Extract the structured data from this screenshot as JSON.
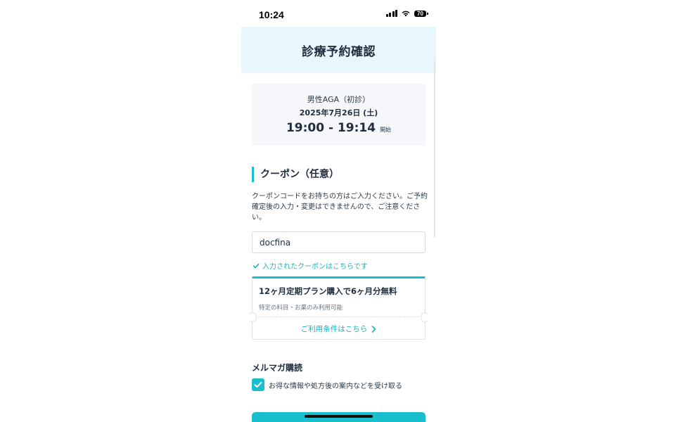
{
  "status_bar": {
    "time": "10:24",
    "battery": "70",
    "icons": [
      "signal-icon",
      "wifi-icon",
      "battery-icon"
    ]
  },
  "header": {
    "title": "診療予約確認"
  },
  "appointment": {
    "menu": "男性AGA（初診）",
    "date": "2025年7月26日 (土)",
    "time": "19:00 - 19:14",
    "start_label": "開始"
  },
  "coupon": {
    "heading": "クーポン（任意）",
    "description": "クーポンコードをお持ちの方はご入力ください。ご予約確定後の入力・変更はできませんので、ご注意ください。",
    "input_value": "docfina",
    "valid_message": "入力されたクーポンはこちらです",
    "ticket": {
      "title": "12ヶ月定期プラン購入で6ヶ月分無料",
      "note": "特定の科目・お薬のみ利用可能",
      "terms_link": "ご利用条件はこちら"
    }
  },
  "newsletter": {
    "heading": "メルマガ購読",
    "checkbox_label": "お得な情報や処方後の案内などを受け取る",
    "checked": true
  },
  "colors": {
    "accent": "#19bfcc",
    "header_bg": "#e8f7fb",
    "card_bg": "#f5f7fa",
    "text": "#1f2d3d"
  }
}
